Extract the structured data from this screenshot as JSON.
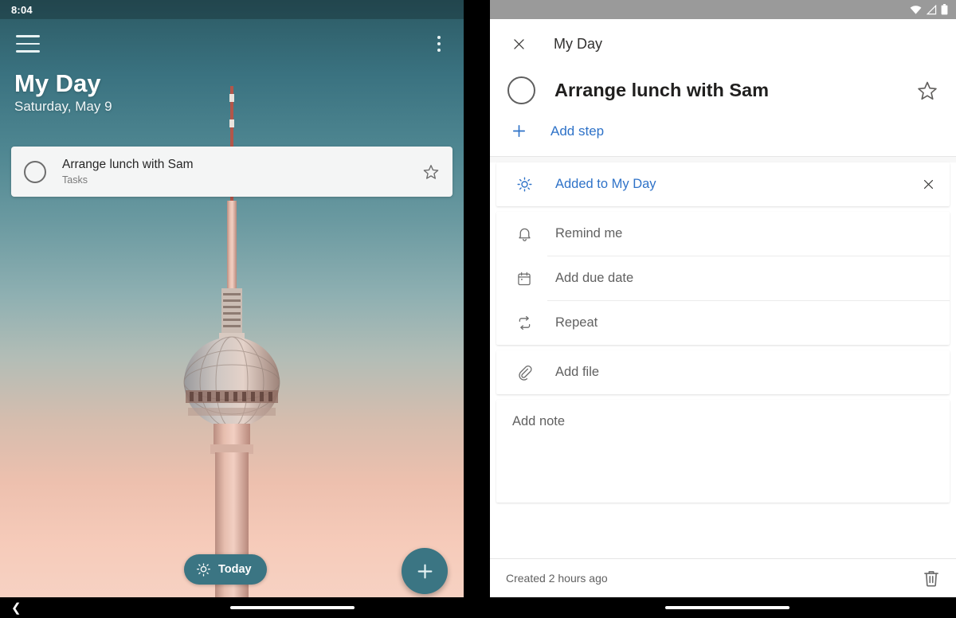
{
  "left": {
    "status_bar": {
      "time": "8:04"
    },
    "app_bar": {
      "menu_icon": "hamburger-menu-icon",
      "overflow_icon": "more-vertical-icon"
    },
    "header": {
      "title": "My Day",
      "date": "Saturday, May 9"
    },
    "task_card": {
      "checkbox_icon": "circle-unchecked-icon",
      "title": "Arrange lunch with Sam",
      "list_name": "Tasks",
      "star_icon": "star-outline-icon"
    },
    "today_pill": {
      "icon": "sun-idea-icon",
      "label": "Today"
    },
    "fab": {
      "icon": "plus-icon",
      "label": "+"
    },
    "nav_bar": {
      "back_icon": "chevron-left-icon",
      "gesture_bar": "home-gesture-bar"
    },
    "background": {
      "photo": "berlin-tv-tower-at-dusk"
    },
    "colors": {
      "accent": "#3b7583",
      "sky_top": "#2c5a64",
      "sky_bottom": "#f7d4c6"
    }
  },
  "right": {
    "status_bar": {
      "wifi_icon": "wifi-icon",
      "signal_icon": "cellular-signal-icon",
      "battery_icon": "battery-icon"
    },
    "detail_header": {
      "close_icon": "close-x-icon",
      "list_title": "My Day"
    },
    "task": {
      "checkbox_icon": "circle-unchecked-icon",
      "title": "Arrange lunch with Sam",
      "star_icon": "star-outline-icon"
    },
    "add_step": {
      "icon": "plus-icon",
      "label": "Add step"
    },
    "my_day": {
      "icon": "sun-icon",
      "label": "Added to My Day",
      "remove_icon": "close-x-icon"
    },
    "options": [
      {
        "icon": "bell-icon",
        "label": "Remind me"
      },
      {
        "icon": "calendar-icon",
        "label": "Add due date"
      },
      {
        "icon": "repeat-icon",
        "label": "Repeat"
      }
    ],
    "add_file": {
      "icon": "paperclip-icon",
      "label": "Add file"
    },
    "note": {
      "placeholder": "Add note",
      "value": ""
    },
    "footer": {
      "created": "Created 2 hours ago",
      "delete_icon": "trash-icon"
    },
    "nav_bar": {
      "gesture_bar": "home-gesture-bar"
    },
    "colors": {
      "link": "#2e72c8",
      "text": "#616161"
    }
  }
}
